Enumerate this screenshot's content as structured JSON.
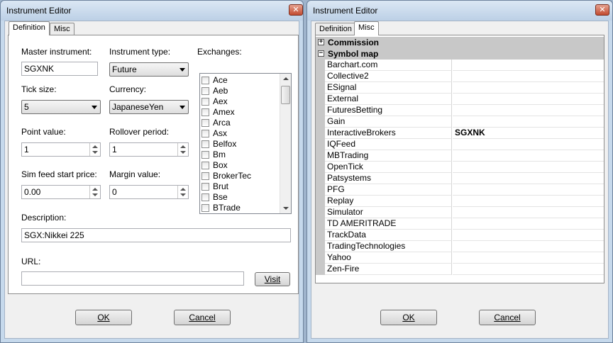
{
  "left_window": {
    "title": "Instrument Editor",
    "tabs": [
      "Definition",
      "Misc"
    ],
    "master_instrument": {
      "label": "Master instrument:",
      "value": "SGXNK"
    },
    "instrument_type": {
      "label": "Instrument type:",
      "value": "Future"
    },
    "exchanges": {
      "label": "Exchanges:",
      "items": [
        "Ace",
        "Aeb",
        "Aex",
        "Amex",
        "Arca",
        "Asx",
        "Belfox",
        "Bm",
        "Box",
        "BrokerTec",
        "Brut",
        "Bse",
        "BTrade"
      ]
    },
    "tick_size": {
      "label": "Tick size:",
      "value": "5"
    },
    "currency": {
      "label": "Currency:",
      "value": "JapaneseYen"
    },
    "point_value": {
      "label": "Point value:",
      "value": "1"
    },
    "rollover_period": {
      "label": "Rollover period:",
      "value": "1"
    },
    "sim_feed_start_price": {
      "label": "Sim feed start price:",
      "value": "0.00"
    },
    "margin_value": {
      "label": "Margin value:",
      "value": "0"
    },
    "description": {
      "label": "Description:",
      "value": "SGX:Nikkei 225"
    },
    "url": {
      "label": "URL:",
      "value": ""
    },
    "visit_label": "Visit",
    "ok_label": "OK",
    "cancel_label": "Cancel"
  },
  "right_window": {
    "title": "Instrument Editor",
    "tabs": [
      "Definition",
      "Misc"
    ],
    "categories": [
      {
        "name": "Commission",
        "expander": "+"
      },
      {
        "name": "Symbol map",
        "expander": "−"
      }
    ],
    "symbol_map": [
      {
        "name": "Barchart.com",
        "value": ""
      },
      {
        "name": "Collective2",
        "value": ""
      },
      {
        "name": "ESignal",
        "value": ""
      },
      {
        "name": "External",
        "value": ""
      },
      {
        "name": "FuturesBetting",
        "value": ""
      },
      {
        "name": "Gain",
        "value": ""
      },
      {
        "name": "InteractiveBrokers",
        "value": "SGXNK"
      },
      {
        "name": "IQFeed",
        "value": ""
      },
      {
        "name": "MBTrading",
        "value": ""
      },
      {
        "name": "OpenTick",
        "value": ""
      },
      {
        "name": "Patsystems",
        "value": ""
      },
      {
        "name": "PFG",
        "value": ""
      },
      {
        "name": "Replay",
        "value": ""
      },
      {
        "name": "Simulator",
        "value": ""
      },
      {
        "name": "TD AMERITRADE",
        "value": ""
      },
      {
        "name": "TrackData",
        "value": ""
      },
      {
        "name": "TradingTechnologies",
        "value": ""
      },
      {
        "name": "Yahoo",
        "value": ""
      },
      {
        "name": "Zen-Fire",
        "value": ""
      }
    ],
    "ok_label": "OK",
    "cancel_label": "Cancel"
  }
}
